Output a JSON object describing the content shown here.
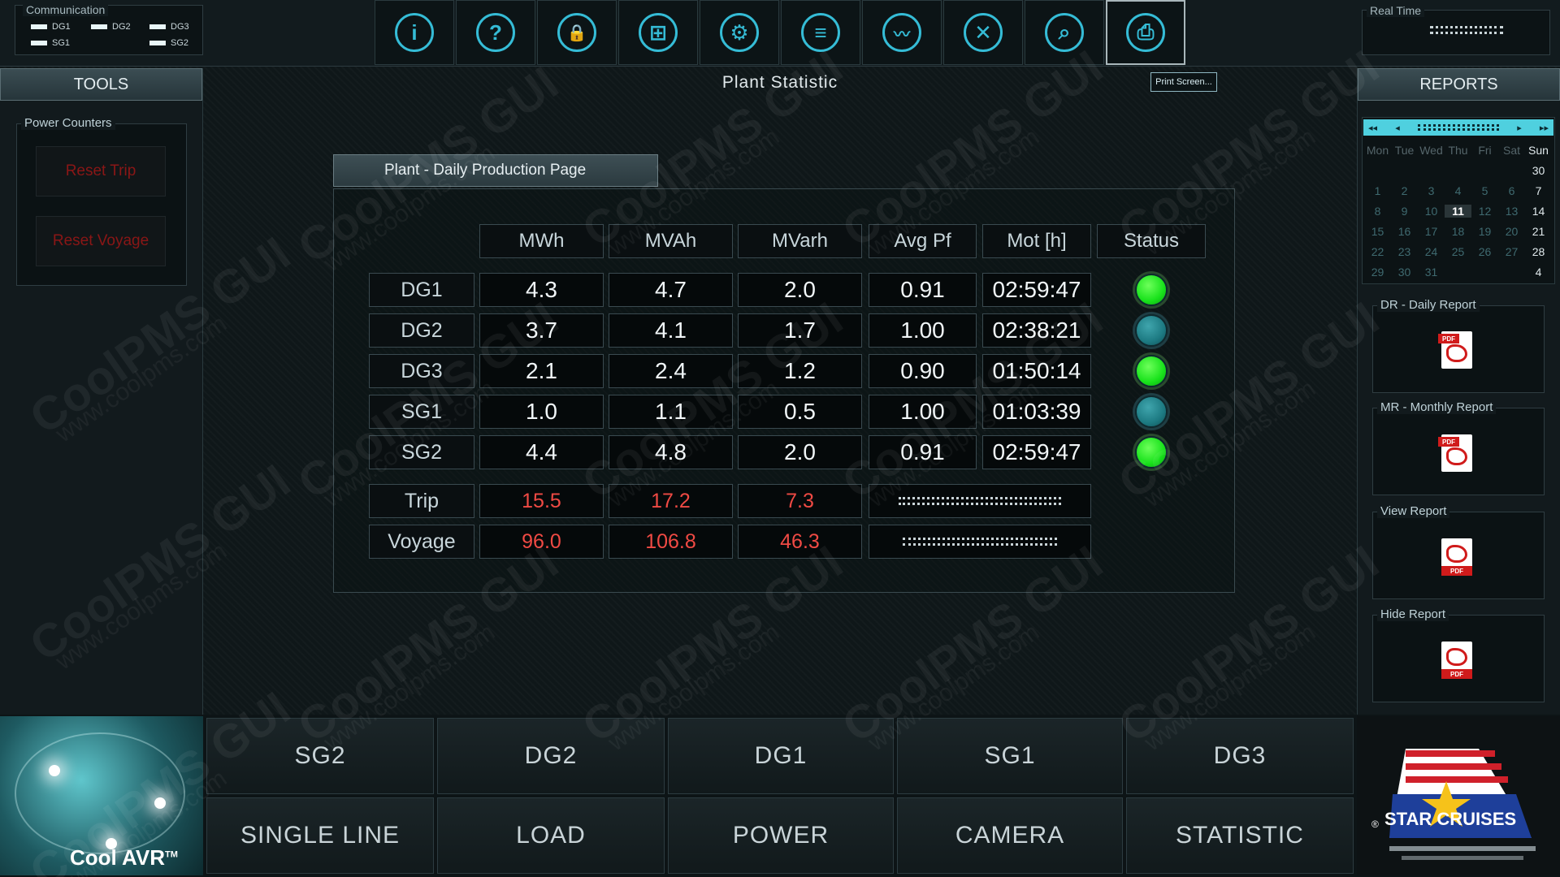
{
  "header": {
    "communication_title": "Communication",
    "communication_items": [
      "DG1",
      "DG2",
      "DG3",
      "SG1",
      "SG2"
    ],
    "realtime_title": "Real Time",
    "toolbar": [
      {
        "icon": "info-icon",
        "glyph": "i"
      },
      {
        "icon": "help-icon",
        "glyph": "?"
      },
      {
        "icon": "lock-icon",
        "glyph": "🔒"
      },
      {
        "icon": "network-icon",
        "glyph": "⊞"
      },
      {
        "icon": "engine-icon",
        "glyph": "⚙"
      },
      {
        "icon": "list-icon",
        "glyph": "≡"
      },
      {
        "icon": "waveform-icon",
        "glyph": "〰"
      },
      {
        "icon": "tools-icon",
        "glyph": "✕"
      },
      {
        "icon": "zoom-icon",
        "glyph": "⌕"
      },
      {
        "icon": "printer-icon",
        "glyph": "⎙"
      }
    ]
  },
  "tools": {
    "title": "TOOLS",
    "group_title": "Power Counters",
    "reset_trip": "Reset Trip",
    "reset_voyage": "Reset Voyage"
  },
  "main": {
    "page_title": "Plant Statistic",
    "print_button": "Print Screen...",
    "sub_tab": "Plant  - Daily Production Page",
    "columns": [
      "MWh",
      "MVAh",
      "MVarh",
      "Avg Pf",
      "Mot [h]",
      "Status"
    ],
    "rows": [
      {
        "label": "DG1",
        "mwh": "4.3",
        "mvah": "4.7",
        "mvarh": "2.0",
        "avgpf": "0.91",
        "mot": "02:59:47",
        "status": "on"
      },
      {
        "label": "DG2",
        "mwh": "3.7",
        "mvah": "4.1",
        "mvarh": "1.7",
        "avgpf": "1.00",
        "mot": "02:38:21",
        "status": "off"
      },
      {
        "label": "DG3",
        "mwh": "2.1",
        "mvah": "2.4",
        "mvarh": "1.2",
        "avgpf": "0.90",
        "mot": "01:50:14",
        "status": "on"
      },
      {
        "label": "SG1",
        "mwh": "1.0",
        "mvah": "1.1",
        "mvarh": "0.5",
        "avgpf": "1.00",
        "mot": "01:03:39",
        "status": "off"
      },
      {
        "label": "SG2",
        "mwh": "4.4",
        "mvah": "4.8",
        "mvarh": "2.0",
        "avgpf": "0.91",
        "mot": "02:59:47",
        "status": "on"
      }
    ],
    "totals": [
      {
        "label": "Trip",
        "mwh": "15.5",
        "mvah": "17.2",
        "mvarh": "7.3"
      },
      {
        "label": "Voyage",
        "mwh": "96.0",
        "mvah": "106.8",
        "mvarh": "46.3"
      }
    ]
  },
  "reports": {
    "title": "REPORTS",
    "calendar": {
      "nav_prev_prev": "◂◂",
      "nav_prev": "◂",
      "nav_next": "▸",
      "nav_next_next": "▸▸",
      "weekdays": [
        "Mon",
        "Tue",
        "Wed",
        "Thu",
        "Fri",
        "Sat",
        "Sun"
      ],
      "weeks": [
        [
          "",
          "",
          "",
          "",
          "",
          "",
          "30"
        ],
        [
          "1",
          "2",
          "3",
          "4",
          "5",
          "6",
          "7"
        ],
        [
          "8",
          "9",
          "10",
          "11",
          "12",
          "13",
          "14"
        ],
        [
          "15",
          "16",
          "17",
          "18",
          "19",
          "20",
          "21"
        ],
        [
          "22",
          "23",
          "24",
          "25",
          "26",
          "27",
          "28"
        ],
        [
          "29",
          "30",
          "31",
          "",
          "",
          "",
          "4"
        ]
      ],
      "today": "11"
    },
    "items": [
      {
        "title": "DR - Daily Report",
        "icon": "pdf-icon",
        "badge": "PDF"
      },
      {
        "title": "MR - Monthly Report",
        "icon": "pdf-icon",
        "badge": "PDF"
      },
      {
        "title": "View Report",
        "icon": "pdf-icon",
        "badge": "PDF"
      },
      {
        "title": "Hide Report",
        "icon": "pdf-icon",
        "badge": "PDF"
      }
    ]
  },
  "nav": {
    "row1": [
      "SG2",
      "DG2",
      "DG1",
      "SG1",
      "DG3"
    ],
    "row2": [
      "SINGLE LINE",
      "LOAD",
      "POWER",
      "CAMERA",
      "STATISTIC"
    ]
  },
  "branding": {
    "left_logo": "Cool AVR",
    "left_logo_tm": "TM",
    "right_logo": "STAR CRUISES",
    "right_logo_reg": "®"
  },
  "watermark": {
    "brand": "CoolPMS GUI",
    "url": "www.coolpms.com"
  },
  "colors": {
    "accent": "#35bcd6",
    "status_on": "#18e21b",
    "status_off": "#1d7a82",
    "totals_text": "#f04a44",
    "reset_text": "#8a1616"
  }
}
